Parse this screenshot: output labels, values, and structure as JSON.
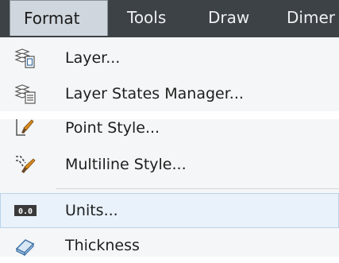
{
  "menubar": {
    "items": [
      {
        "label": "Format"
      },
      {
        "label": "Tools"
      },
      {
        "label": "Draw"
      },
      {
        "label": "Dimer"
      }
    ]
  },
  "menu": {
    "items": [
      {
        "label": "Layer...",
        "icon": "layer-properties-icon"
      },
      {
        "label": "Layer States Manager...",
        "icon": "layer-states-icon"
      },
      {
        "label": "Point Style...",
        "icon": "point-style-icon"
      },
      {
        "label": "Multiline Style...",
        "icon": "multiline-style-icon"
      },
      {
        "label": "Units...",
        "icon": "units-icon"
      },
      {
        "label": "Thickness",
        "icon": "thickness-icon"
      }
    ]
  },
  "units_icon_text": "0.0"
}
